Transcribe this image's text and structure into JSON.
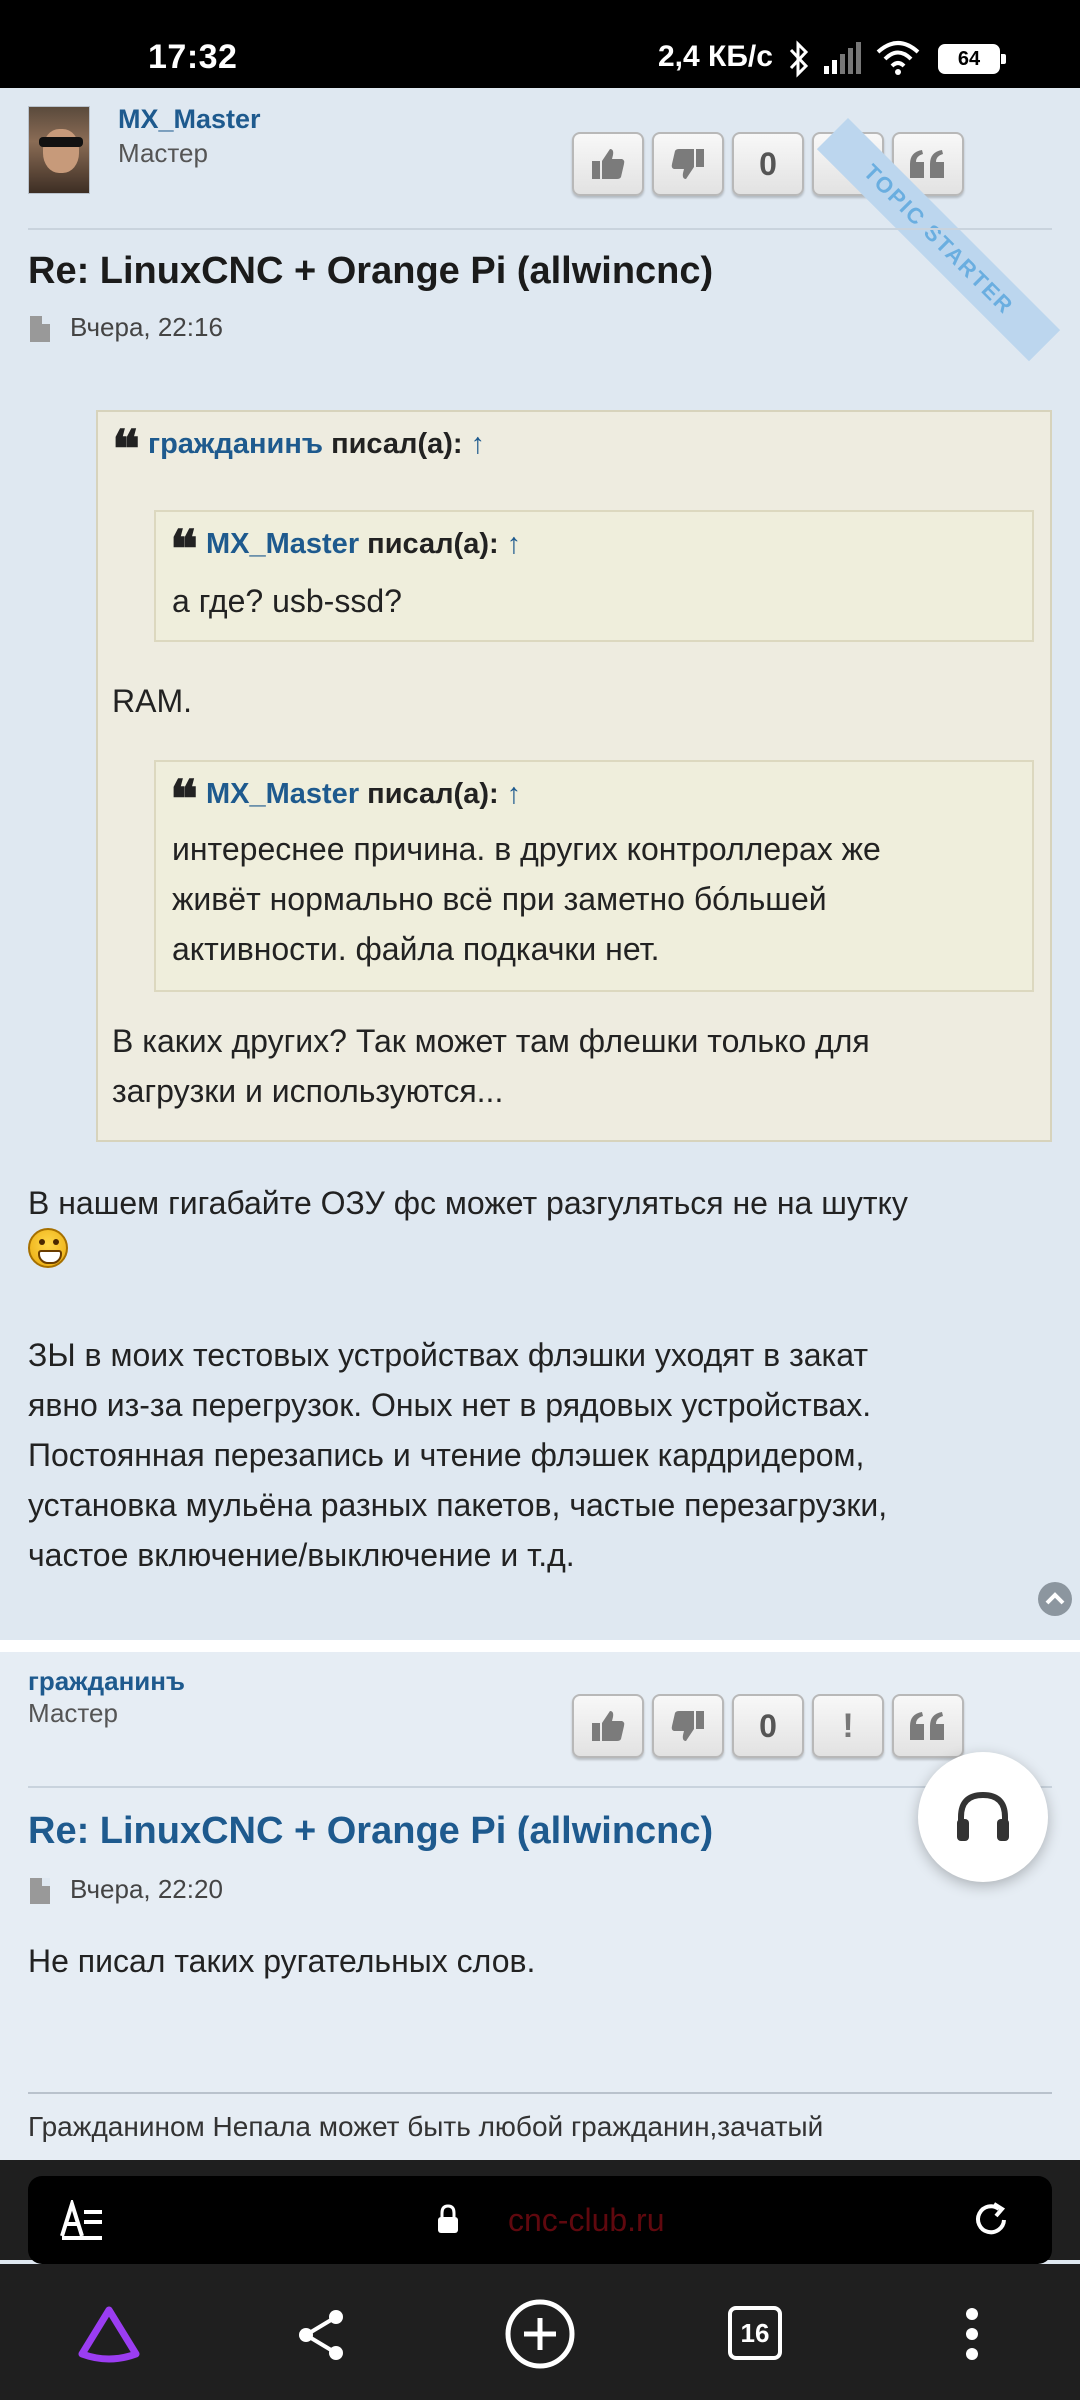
{
  "status_bar": {
    "time": "17:32",
    "speed": "2,4 КБ/с",
    "battery": "64"
  },
  "post1": {
    "author": "MX_Master",
    "rank": "Мастер",
    "ribbon": "TOPIC STARTER",
    "buttons": {
      "like": "like",
      "dislike": "dislike",
      "count": "0",
      "report": "!",
      "quote": "quote"
    },
    "title": "Re: LinuxCNC + Orange Pi (allwincnc)",
    "date": "Вчера, 22:16",
    "quote_outer": {
      "author": "гражданинъ",
      "wrote": "писал(а):",
      "arrow": "↑",
      "nested1": {
        "author": "MX_Master",
        "wrote": "писал(а):",
        "arrow": "↑",
        "text": "а где? usb-ssd?"
      },
      "text1": "RAM.",
      "nested2": {
        "author": "MX_Master",
        "wrote": "писал(а):",
        "arrow": "↑",
        "lines": [
          "интереснее причина. в других контроллерах же",
          "живёт нормально всё при заметно бóльшей",
          "активности. файла подкачки нет."
        ]
      },
      "text2_lines": [
        "В каких других? Так может там флешки только для",
        "загрузки и используются..."
      ]
    },
    "body1": "В нашем гигабайте ОЗУ фс может разгуляться не на шутку",
    "body2_lines": [
      "ЗЫ в моих тестовых устройствах флэшки уходят в закат",
      "явно из-за перегрузок. Оных нет в рядовых устройствах.",
      "Постоянная перезапись и чтение флэшек кардридером,",
      "установка мульёна разных пакетов, частые перезагрузки,",
      "частое включение/выключение и т.д."
    ]
  },
  "post2": {
    "author": "гражданинъ",
    "rank": "Мастер",
    "count": "0",
    "report": "!",
    "title": "Re: LinuxCNC + Orange Pi (allwincnc)",
    "date": "Вчера, 22:20",
    "body": "Не писал таких ругательных слов.",
    "signature": "Гражданином Непала может быть любой гражданин,зачатый"
  },
  "browser": {
    "url": "cnc-club.ru",
    "tabs_count": "16"
  }
}
